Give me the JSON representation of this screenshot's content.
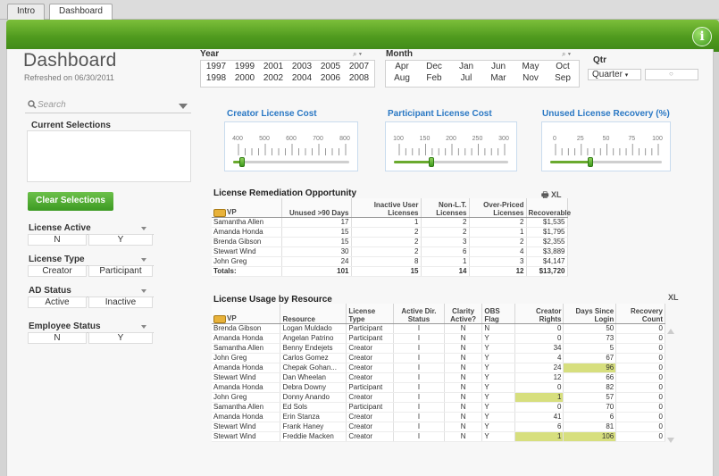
{
  "tabs": [
    {
      "label": "Intro"
    },
    {
      "label": "Dashboard"
    }
  ],
  "header": {
    "title": "Dashboard",
    "refreshed": "Refreshed on 06/30/2011",
    "info_icon": "i"
  },
  "filters": {
    "year": {
      "label": "Year",
      "values": [
        "1997",
        "1999",
        "2001",
        "2003",
        "2005",
        "2007",
        "1998",
        "2000",
        "2002",
        "2004",
        "2006",
        "2008"
      ]
    },
    "month": {
      "label": "Month",
      "values": [
        "Apr",
        "Dec",
        "Jan",
        "Jun",
        "May",
        "Oct",
        "Aug",
        "Feb",
        "Jul",
        "Mar",
        "Nov",
        "Sep"
      ]
    },
    "qtr": {
      "label": "Qtr",
      "selected": "Quarter",
      "field_marker": "○"
    },
    "control_icons": "⌕ ▾"
  },
  "sidebar": {
    "search_placeholder": "Search",
    "current_selections": "Current Selections",
    "clear_button": "Clear Selections",
    "listboxes": [
      {
        "label": "License Active",
        "values": [
          "N",
          "Y"
        ]
      },
      {
        "label": "License Type",
        "values": [
          "Creator",
          "Participant"
        ]
      },
      {
        "label": "AD Status",
        "values": [
          "Active",
          "Inactive"
        ]
      },
      {
        "label": "Employee Status",
        "values": [
          "N",
          "Y"
        ]
      }
    ]
  },
  "sliders": [
    {
      "label": "Creator License Cost",
      "ticks": [
        "400",
        "500",
        "600",
        "700",
        "800"
      ],
      "value_fraction": 0.08
    },
    {
      "label": "Participant License Cost",
      "ticks": [
        "100",
        "150",
        "200",
        "250",
        "300"
      ],
      "value_fraction": 0.33
    },
    {
      "label": "Unused License Recovery (%)",
      "ticks": [
        "0",
        "25",
        "50",
        "75",
        "100"
      ],
      "value_fraction": 0.36
    }
  ],
  "remediation": {
    "title": "License Remediation Opportunity",
    "icons": "🖶 XL",
    "headers": [
      "VP",
      "Unused >90 Days",
      "Inactive User Licenses",
      "Non-L.T. Licenses",
      "Over-Priced Licenses",
      "Recoverable"
    ],
    "rows": [
      [
        "Samantha Allen",
        "17",
        "1",
        "2",
        "2",
        "$1,535"
      ],
      [
        "Amanda Honda",
        "15",
        "2",
        "2",
        "1",
        "$1,795"
      ],
      [
        "Brenda Gibson",
        "15",
        "2",
        "3",
        "2",
        "$2,355"
      ],
      [
        "Stewart Wind",
        "30",
        "2",
        "6",
        "4",
        "$3,889"
      ],
      [
        "John Greg",
        "24",
        "8",
        "1",
        "3",
        "$4,147"
      ]
    ],
    "totals": [
      "Totals:",
      "101",
      "15",
      "14",
      "12",
      "$13,720"
    ]
  },
  "usage": {
    "title": "License Usage by Resource",
    "icons": "XL",
    "headers": [
      "VP",
      "Resource",
      "License Type",
      "Active Dir. Status",
      "Clarity Active?",
      "OBS Flag",
      "Creator Rights",
      "Days Since Login",
      "Recovery Count"
    ],
    "rows": [
      [
        "Brenda Gibson",
        "Logan Muldado",
        "Participant",
        "I",
        "N",
        "N",
        "0",
        "50",
        "0"
      ],
      [
        "Amanda Honda",
        "Angelan Patrino",
        "Participant",
        "I",
        "N",
        "Y",
        "0",
        "73",
        "0"
      ],
      [
        "Samantha Allen",
        "Benny Endejets",
        "Creator",
        "I",
        "N",
        "Y",
        "34",
        "5",
        "0"
      ],
      [
        "John Greg",
        "Carlos Gomez",
        "Creator",
        "I",
        "N",
        "Y",
        "4",
        "67",
        "0"
      ],
      [
        "Amanda Honda",
        "Chepak Gohan...",
        "Creator",
        "I",
        "N",
        "Y",
        "24",
        "96",
        "0"
      ],
      [
        "Stewart Wind",
        "Dan Wheelan",
        "Creator",
        "I",
        "N",
        "Y",
        "12",
        "66",
        "0"
      ],
      [
        "Amanda Honda",
        "Debra Downy",
        "Participant",
        "I",
        "N",
        "Y",
        "0",
        "82",
        "0"
      ],
      [
        "John Greg",
        "Donny Anando",
        "Creator",
        "I",
        "N",
        "Y",
        "1",
        "57",
        "0"
      ],
      [
        "Samantha Allen",
        "Ed Sols",
        "Participant",
        "I",
        "N",
        "Y",
        "0",
        "70",
        "0"
      ],
      [
        "Amanda Honda",
        "Erin Stanza",
        "Creator",
        "I",
        "N",
        "Y",
        "41",
        "6",
        "0"
      ],
      [
        "Stewart Wind",
        "Frank Haney",
        "Creator",
        "I",
        "N",
        "Y",
        "6",
        "81",
        "0"
      ],
      [
        "Stewart Wind",
        "Freddie Macken",
        "Creator",
        "I",
        "N",
        "Y",
        "1",
        "106",
        "0"
      ]
    ],
    "highlight_color": "#d7df7e"
  },
  "colors": {
    "brand_green": "#4f9a1e",
    "link_blue": "#2a78c4"
  }
}
